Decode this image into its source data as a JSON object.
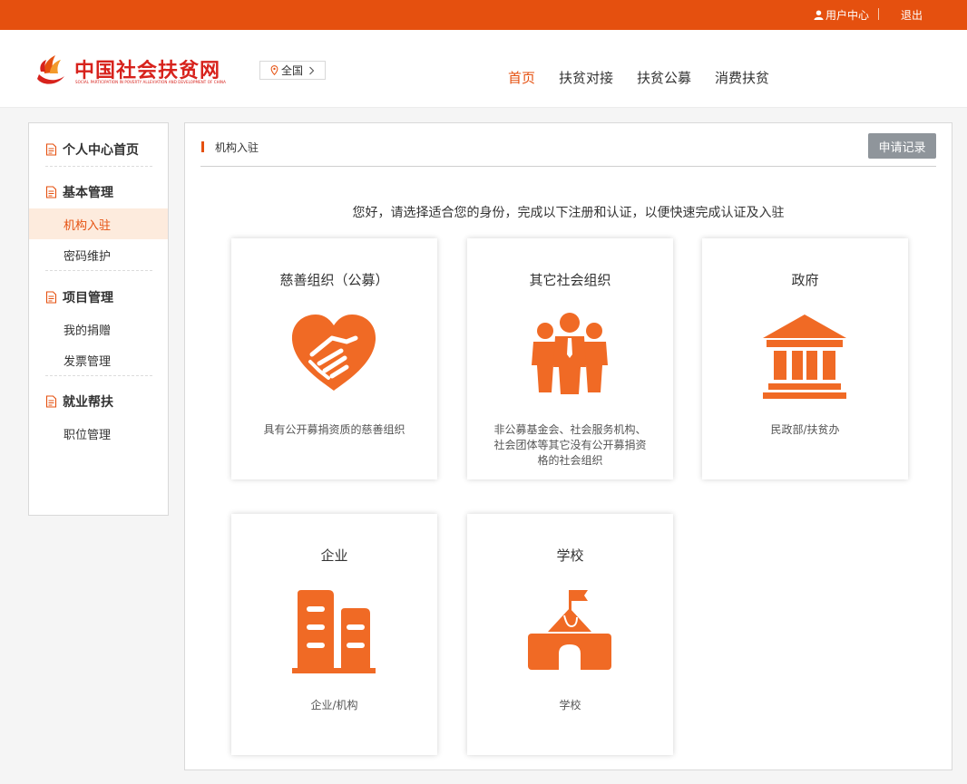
{
  "topbar": {
    "user_center": "用户中心",
    "logout": "退出"
  },
  "header": {
    "logo_cn": "中国社会扶贫网",
    "logo_en": "SOCIAL PARTICIPATION IN POVERTY ALLEVIATION AND DEVELOPMENT OF CHINA",
    "region": "全国",
    "nav": [
      {
        "label": "首页",
        "active": true
      },
      {
        "label": "扶贫对接",
        "active": false
      },
      {
        "label": "扶贫公募",
        "active": false
      },
      {
        "label": "消费扶贫",
        "active": false
      }
    ]
  },
  "sidebar": {
    "sections": [
      {
        "label": "个人中心首页",
        "items": []
      },
      {
        "label": "基本管理",
        "items": [
          {
            "label": "机构入驻",
            "active": true
          },
          {
            "label": "密码维护",
            "active": false
          }
        ]
      },
      {
        "label": "项目管理",
        "items": [
          {
            "label": "我的捐赠",
            "active": false
          },
          {
            "label": "发票管理",
            "active": false
          }
        ]
      },
      {
        "label": "就业帮扶",
        "items": [
          {
            "label": "职位管理",
            "active": false
          }
        ]
      }
    ]
  },
  "main": {
    "title": "机构入驻",
    "apply_record_button": "申请记录",
    "intro": "您好，请选择适合您的身份，完成以下注册和认证，以便快速完成认证及入驻",
    "cards": [
      {
        "title": "慈善组织（公募）",
        "icon": "handshake-heart-icon",
        "desc": "具有公开募捐资质的慈善组织"
      },
      {
        "title": "其它社会组织",
        "icon": "people-group-icon",
        "desc": "非公募基金会、社会服务机构、社会团体等其它没有公开募捐资格的社会组织"
      },
      {
        "title": "政府",
        "icon": "government-building-icon",
        "desc": "民政部/扶贫办"
      },
      {
        "title": "企业",
        "icon": "office-buildings-icon",
        "desc": "企业/机构"
      },
      {
        "title": "学校",
        "icon": "school-flag-icon",
        "desc": "学校"
      }
    ]
  },
  "colors": {
    "brand": "#e5500f",
    "icon": "#f06a25",
    "logo_red": "#d7221c",
    "active_bg": "#fdebdd",
    "button_gray": "#8f959b"
  }
}
